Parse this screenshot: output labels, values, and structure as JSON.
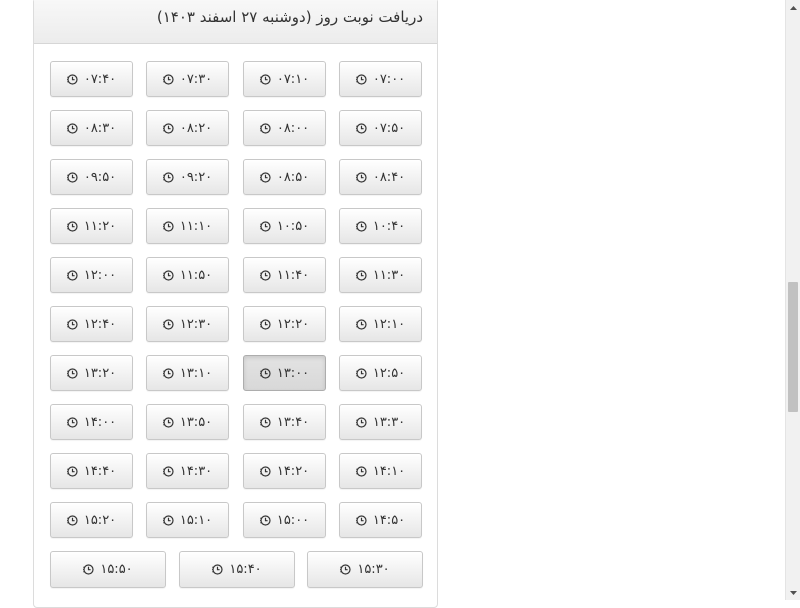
{
  "panel": {
    "title": "دریافت نوبت روز (دوشنبه ۲۷ اسفند ۱۴۰۳)"
  },
  "slot_icon": "clock-icon",
  "selected_slot": "۱۳:۰۰",
  "rows": [
    [
      "۰۷:۰۰",
      "۰۷:۱۰",
      "۰۷:۳۰",
      "۰۷:۴۰"
    ],
    [
      "۰۷:۵۰",
      "۰۸:۰۰",
      "۰۸:۲۰",
      "۰۸:۳۰"
    ],
    [
      "۰۸:۴۰",
      "۰۸:۵۰",
      "۰۹:۲۰",
      "۰۹:۵۰"
    ],
    [
      "۱۰:۴۰",
      "۱۰:۵۰",
      "۱۱:۱۰",
      "۱۱:۲۰"
    ],
    [
      "۱۱:۳۰",
      "۱۱:۴۰",
      "۱۱:۵۰",
      "۱۲:۰۰"
    ],
    [
      "۱۲:۱۰",
      "۱۲:۲۰",
      "۱۲:۳۰",
      "۱۲:۴۰"
    ],
    [
      "۱۲:۵۰",
      "۱۳:۰۰",
      "۱۳:۱۰",
      "۱۳:۲۰"
    ],
    [
      "۱۳:۳۰",
      "۱۳:۴۰",
      "۱۳:۵۰",
      "۱۴:۰۰"
    ],
    [
      "۱۴:۱۰",
      "۱۴:۲۰",
      "۱۴:۳۰",
      "۱۴:۴۰"
    ],
    [
      "۱۴:۵۰",
      "۱۵:۰۰",
      "۱۵:۱۰",
      "۱۵:۲۰"
    ],
    [
      "۱۵:۳۰",
      "۱۵:۴۰",
      "۱۵:۵۰"
    ]
  ]
}
